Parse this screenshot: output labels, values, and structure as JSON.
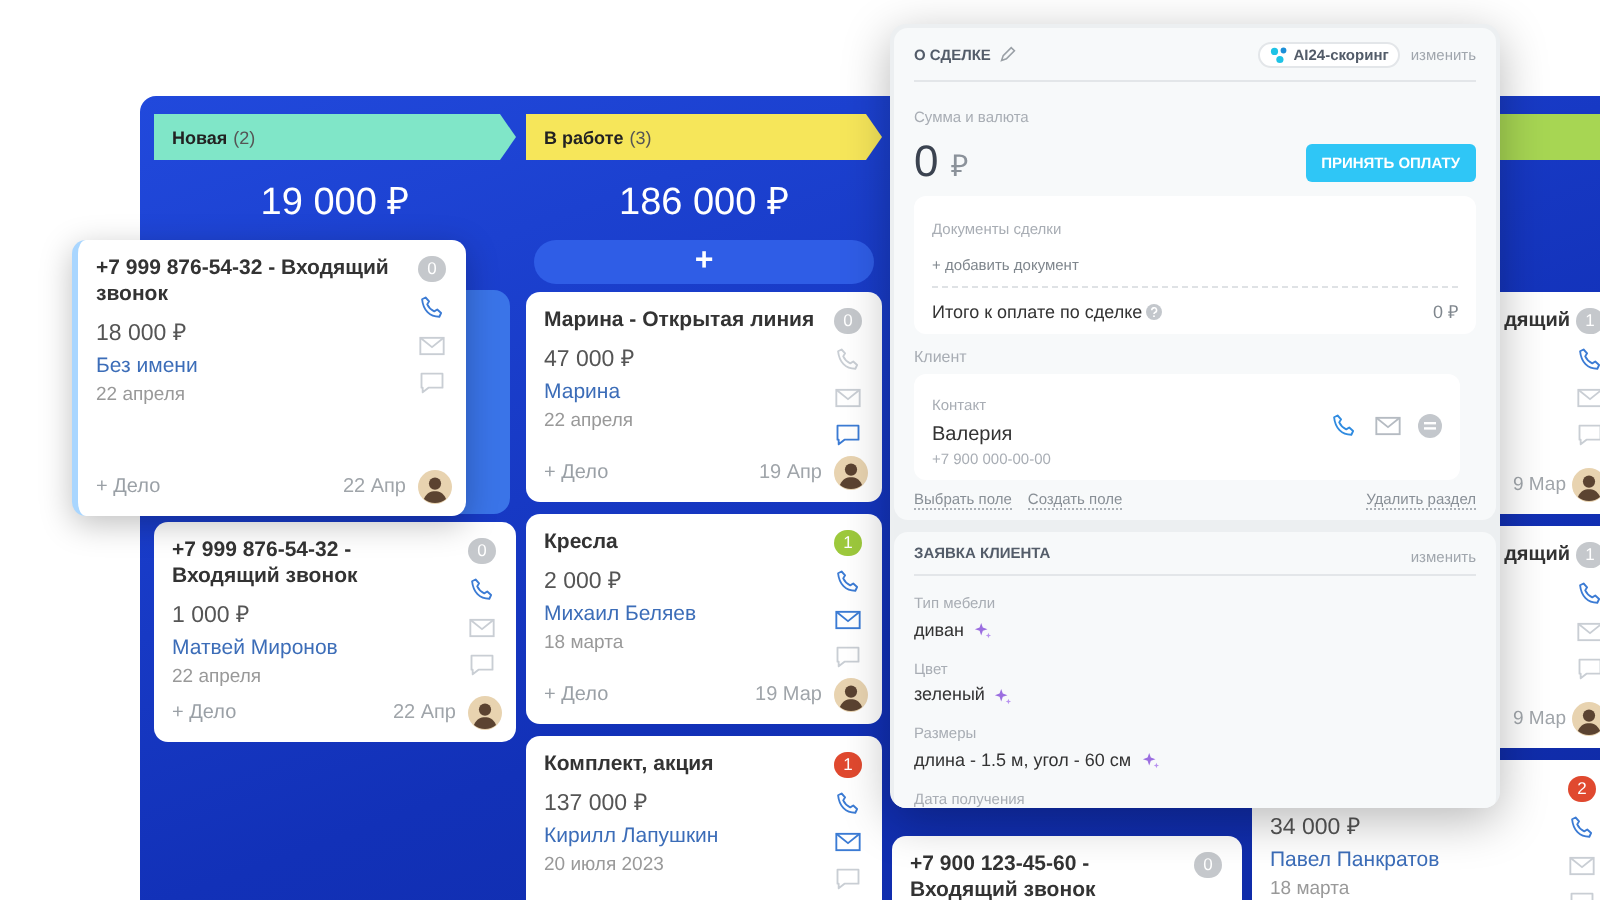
{
  "board": {
    "columns": [
      {
        "title": "Новая",
        "count": "(2)",
        "color": "#80e6c8",
        "total": "19 000 ₽",
        "drop_zone": true,
        "cards": [
          {
            "kind": "full",
            "title": "+7 999 876-54-32 - Входящий звонок",
            "badge": "0",
            "color": "#c5c8cc",
            "amount": "1 000 ₽",
            "contact": "Матвей Миронов",
            "date": "22 апреля",
            "action": "+ Дело",
            "footer_date": "22 Апр",
            "phone": true,
            "mail": false,
            "chat": false
          }
        ]
      },
      {
        "title": "В работе",
        "count": "(3)",
        "color": "#f6e65a",
        "total": "186 000 ₽",
        "add_button": "+",
        "cards": [
          {
            "kind": "full",
            "title": "Марина - Открытая линия",
            "badge": "0",
            "color": "#c5c8cc",
            "amount": "47 000 ₽",
            "contact": "Марина",
            "date": "22 апреля",
            "action": "+ Дело",
            "footer_date": "19 Апр",
            "phone": false,
            "mail": false,
            "chat": true
          },
          {
            "kind": "full",
            "title": "Кресла",
            "badge": "1",
            "color": "#9dc93c",
            "amount": "2 000 ₽",
            "contact": "Михаил Беляев",
            "date": "18 марта",
            "action": "+ Дело",
            "footer_date": "19 Мар",
            "phone": true,
            "mail": true,
            "chat": false
          },
          {
            "kind": "full",
            "title": "Комплект, акция",
            "badge": "1",
            "color": "#e0492f",
            "amount": "137 000 ₽",
            "contact": "Кирилл Лапушкин",
            "date": "20 июля 2023",
            "phone": true,
            "mail": true,
            "chat": false
          }
        ]
      },
      {
        "cards": [
          {
            "kind": "full",
            "title": "+7 900 123-45-60 - Входящий звонок",
            "badge": "0",
            "color": "#c5c8cc"
          }
        ]
      },
      {
        "color": "#a7d653",
        "cards": [
          {
            "kind": "partial",
            "title": "дящий",
            "badge": "1",
            "color": "#c5c8cc",
            "footer_date": "9 Мар",
            "phone": true,
            "mail": false,
            "chat": false
          },
          {
            "kind": "partial",
            "title": "дящий",
            "badge": "1",
            "color": "#c5c8cc",
            "footer_date": "9 Мар",
            "phone": true,
            "mail": false,
            "chat": false
          },
          {
            "kind": "full",
            "badge": "2",
            "color": "#e0492f",
            "amount": "34 000 ₽",
            "contact": "Павел Панкратов",
            "date": "18 марта",
            "phone": true,
            "mail": false,
            "chat": false
          }
        ]
      }
    ]
  },
  "dragged_card": {
    "title": "+7 999 876-54-32 - Входящий звонок",
    "badge": "0",
    "color": "#c5c8cc",
    "amount": "18 000 ₽",
    "contact": "Без имени",
    "date": "22 апреля",
    "action": "+ Дело",
    "footer_date": "22 Апр",
    "phone": true,
    "mail": false,
    "chat": false
  },
  "deal_panel": {
    "title": "О СДЕЛКЕ",
    "scoring": "AI24-скоринг",
    "edit": "изменить",
    "amount_label": "Сумма и валюта",
    "amount": "0",
    "currency": "₽",
    "pay_button": "ПРИНЯТЬ ОПЛАТУ",
    "documents": {
      "label": "Документы сделки",
      "add": "+ добавить документ",
      "total_label": "Итого к оплате по сделке",
      "total": "0 ₽"
    },
    "client": {
      "label": "Клиент",
      "contact_label": "Контакт",
      "name": "Валерия",
      "phone": "+7 900 000-00-00"
    },
    "links": [
      "Выбрать поле",
      "Создать поле"
    ],
    "delete_link": "Удалить раздел",
    "request": {
      "title": "ЗАЯВКА КЛИЕНТА",
      "edit": "изменить",
      "fields": [
        {
          "label": "Тип мебели",
          "value": "диван",
          "ai": true
        },
        {
          "label": "Цвет",
          "value": "зеленый",
          "ai": true
        },
        {
          "label": "Размеры",
          "value": "длина - 1.5 м, угол - 60 см",
          "ai": true
        },
        {
          "label": "Дата получения"
        }
      ]
    }
  }
}
